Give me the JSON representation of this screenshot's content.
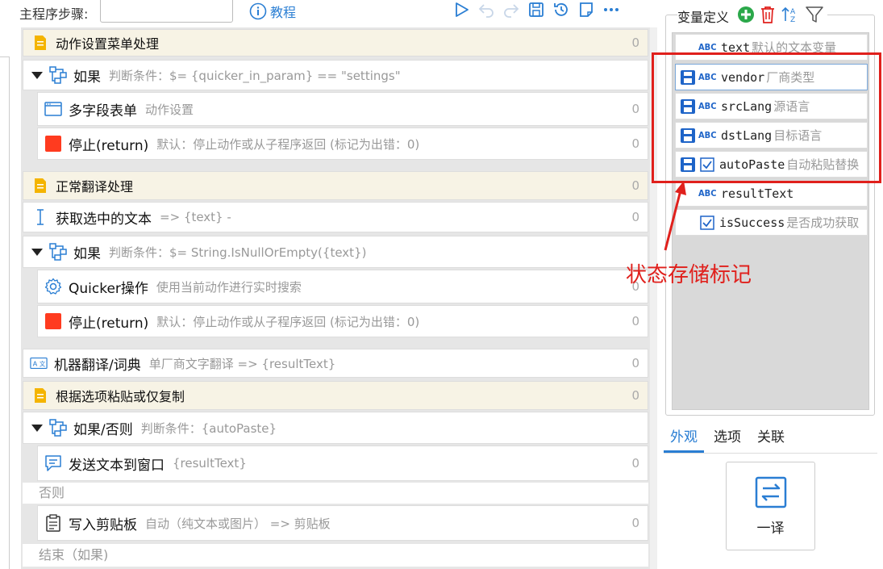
{
  "toolbar": {
    "main_steps_label": "主程序步骤:",
    "step_input_value": "",
    "tutorial_label": "教程"
  },
  "steps": [
    {
      "title": "动作设置菜单处理",
      "sub": "",
      "count": "0"
    },
    {
      "title": "如果",
      "sub": "判断条件：$= {quicker_in_param} == \"settings\"",
      "count": ""
    },
    {
      "title": "多字段表单",
      "sub": "动作设置",
      "count": "0"
    },
    {
      "title": "停止(return)",
      "sub": "默认：停止动作或从子程序返回 (标记为出错：0)",
      "count": "0"
    },
    {
      "title": "正常翻译处理",
      "sub": "",
      "count": "0"
    },
    {
      "title": "获取选中的文本",
      "sub": "=> {text} -",
      "count": "0"
    },
    {
      "title": "如果",
      "sub": "判断条件：$= String.IsNullOrEmpty({text})",
      "count": ""
    },
    {
      "title": "Quicker操作",
      "sub": "使用当前动作进行实时搜索",
      "count": "0"
    },
    {
      "title": "停止(return)",
      "sub": "默认：停止动作或从子程序返回 (标记为出错：0)",
      "count": "0"
    },
    {
      "title": "机器翻译/词典",
      "sub": "单厂商文字翻译 => {resultText}",
      "count": "0"
    },
    {
      "title": "根据选项粘贴或仅复制",
      "sub": "",
      "count": "0"
    },
    {
      "title": "如果/否则",
      "sub": "判断条件：{autoPaste}",
      "count": ""
    },
    {
      "title": "发送文本到窗口",
      "sub": "{resultText}",
      "count": "0"
    },
    {
      "title": "写入剪贴板",
      "sub": "自动（纯文本或图片） => 剪贴板",
      "count": "0"
    }
  ],
  "labels": {
    "else": "否则",
    "end_if": "结束（如果)"
  },
  "variables": {
    "title": "变量定义",
    "items": [
      {
        "name": "text",
        "desc": "默认的文本变量",
        "type": "ABC"
      },
      {
        "name": "vendor",
        "desc": "厂商类型",
        "type": "ABC"
      },
      {
        "name": "srcLang",
        "desc": "源语言",
        "type": "ABC"
      },
      {
        "name": "dstLang",
        "desc": "目标语言",
        "type": "ABC"
      },
      {
        "name": "autoPaste",
        "desc": "自动粘贴替换",
        "type": "bool"
      },
      {
        "name": "resultText",
        "desc": "",
        "type": "ABC"
      },
      {
        "name": "isSuccess",
        "desc": "是否成功获取",
        "type": "bool"
      }
    ]
  },
  "annotation": "状态存储标记",
  "tabs": [
    "外观",
    "选项",
    "关联"
  ],
  "appearance": {
    "label": "一译"
  },
  "colors": {
    "accent": "#2a7ed3",
    "annotation": "#e0201c",
    "stop": "#ff3b1f",
    "save_icon": "#1e64c8"
  }
}
